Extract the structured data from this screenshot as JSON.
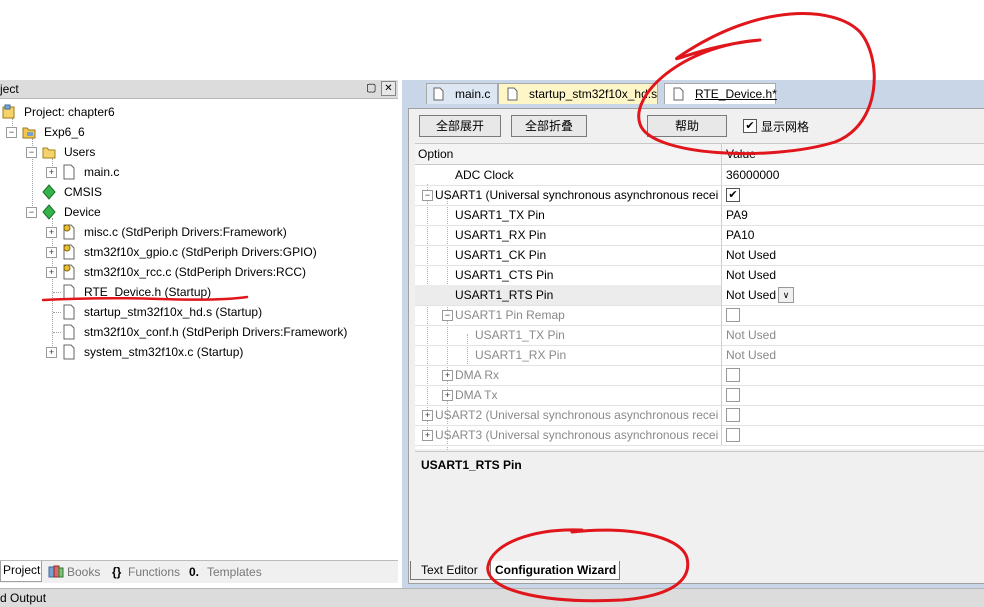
{
  "project_panel": {
    "title": "ject",
    "tree": {
      "project": "Project: chapter6",
      "target": "Exp6_6",
      "groups": {
        "users": "Users",
        "main_c": "main.c",
        "cmsis": "CMSIS",
        "device": "Device",
        "misc": "misc.c (StdPeriph Drivers:Framework)",
        "gpio": "stm32f10x_gpio.c (StdPeriph Drivers:GPIO)",
        "rcc": "stm32f10x_rcc.c (StdPeriph Drivers:RCC)",
        "rte": "RTE_Device.h (Startup)",
        "startup": "startup_stm32f10x_hd.s (Startup)",
        "conf": "stm32f10x_conf.h (StdPeriph Drivers:Framework)",
        "system": "system_stm32f10x.c (Startup)"
      }
    },
    "tabs": {
      "project": "Project",
      "books": "Books",
      "functions": "Functions",
      "templates": "Templates"
    }
  },
  "editor": {
    "file_tabs": {
      "main": "main.c",
      "startup": "startup_stm32f10x_hd.s",
      "rte": "RTE_Device.h*"
    },
    "toolbar": {
      "expand_all": "全部展开",
      "collapse_all": "全部折叠",
      "help": "帮助",
      "show_grid": "显示网格"
    },
    "grid": {
      "header_option": "Option",
      "header_value": "Value",
      "rows": {
        "adc_clock": {
          "option": "ADC Clock",
          "value": "36000000"
        },
        "usart1": {
          "option": "USART1 (Universal synchronous asynchronous recei..."
        },
        "tx": {
          "option": "USART1_TX Pin",
          "value": "PA9"
        },
        "rx": {
          "option": "USART1_RX Pin",
          "value": "PA10"
        },
        "ck": {
          "option": "USART1_CK Pin",
          "value": "Not Used"
        },
        "cts": {
          "option": "USART1_CTS Pin",
          "value": "Not Used"
        },
        "rts": {
          "option": "USART1_RTS Pin",
          "value": "Not Used"
        },
        "remap": {
          "option": "USART1 Pin Remap"
        },
        "remap_tx": {
          "option": "USART1_TX Pin",
          "value": "Not Used"
        },
        "remap_rx": {
          "option": "USART1_RX Pin",
          "value": "Not Used"
        },
        "dma_rx": {
          "option": "DMA Rx"
        },
        "dma_tx": {
          "option": "DMA Tx"
        },
        "usart2": {
          "option": "USART2 (Universal synchronous asynchronous recei..."
        },
        "usart3": {
          "option": "USART3 (Universal synchronous asynchronous recei..."
        }
      }
    },
    "description": "USART1_RTS Pin",
    "bottom_tabs": {
      "text_editor": "Text Editor",
      "config_wizard": "Configuration Wizard"
    }
  },
  "status_bar": {
    "text": "d Output"
  },
  "colors": {
    "annotation": "#e0161c",
    "panel_bg": "#c9d6e8",
    "active_tab": "#fff6c8"
  }
}
